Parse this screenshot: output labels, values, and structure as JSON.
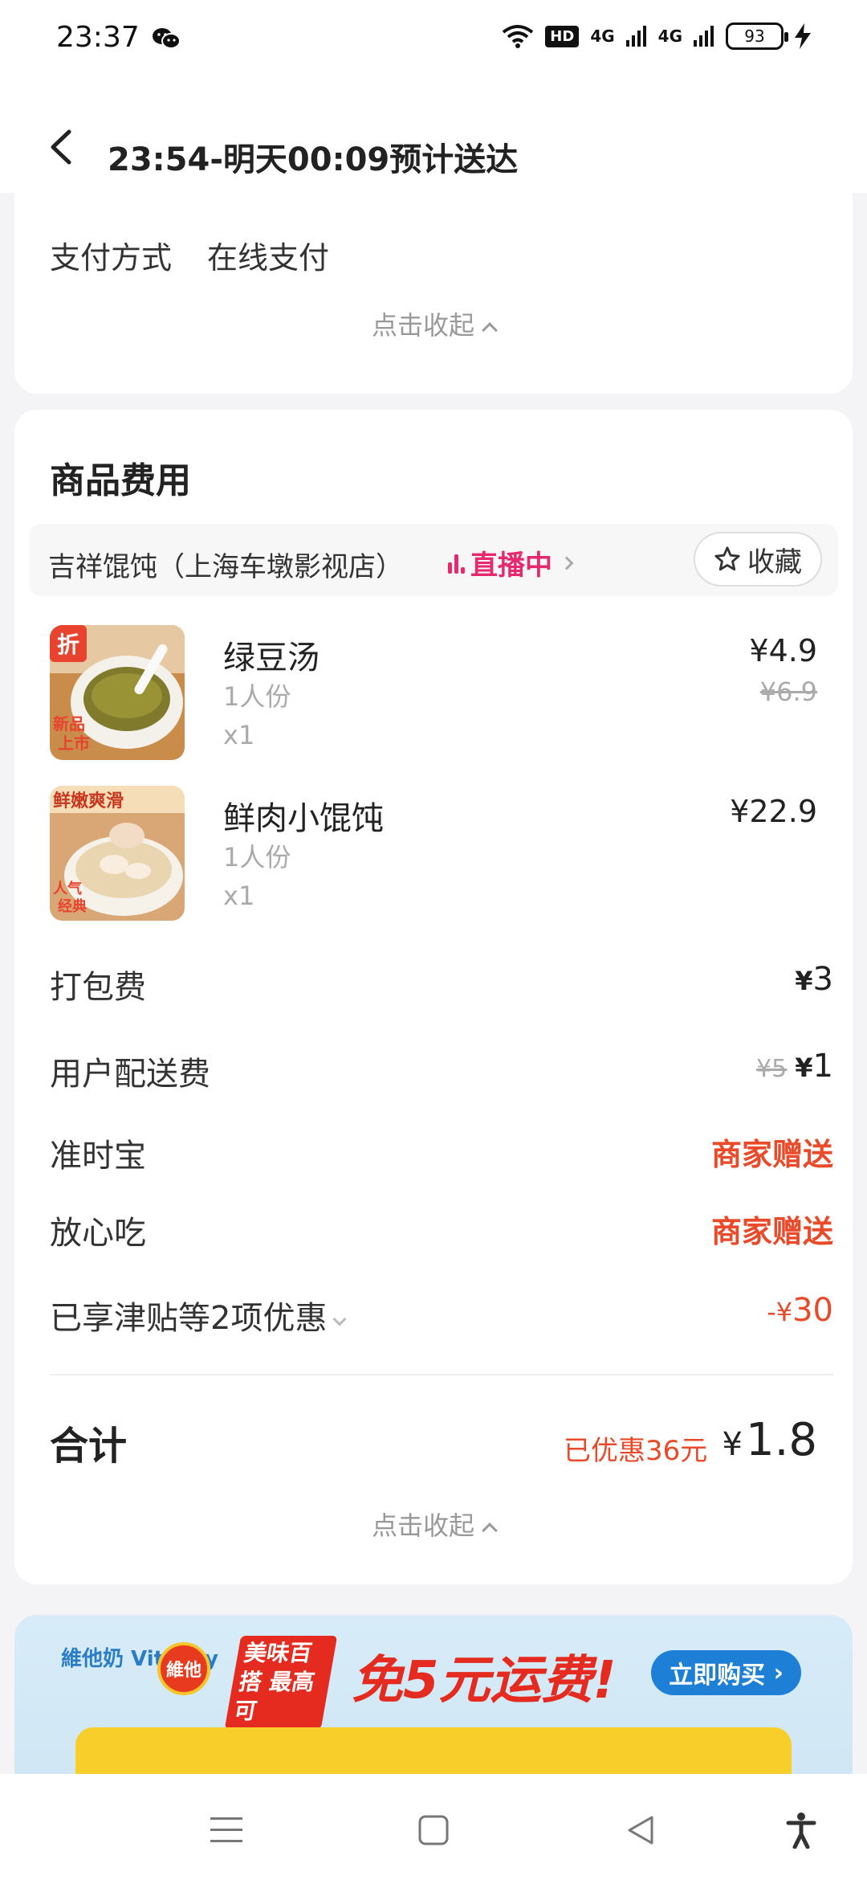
{
  "status_bar": {
    "time": "23:37",
    "hd_label": "HD",
    "signal1": "4G",
    "signal2": "4G",
    "battery": "93",
    "icons": [
      "wechat-icon",
      "wifi-icon",
      "signal-icon",
      "battery-icon",
      "charging-icon"
    ]
  },
  "header": {
    "title": "23:54-明天00:09预计送达"
  },
  "payment": {
    "label": "支付方式",
    "value": "在线支付",
    "collapse_label": "点击收起"
  },
  "fees": {
    "section_title": "商品费用",
    "shop": {
      "name": "吉祥馄饨（上海车墩影视店）",
      "live_label": "直播中",
      "favorite_label": "收藏"
    },
    "items": [
      {
        "name": "绿豆汤",
        "spec": "1人份",
        "qty": "x1",
        "price": "¥4.9",
        "original_price": "¥6.9",
        "badge": "折",
        "tag": "新品上市"
      },
      {
        "name": "鲜肉小馄饨",
        "spec": "1人份",
        "qty": "x1",
        "price": "¥22.9",
        "badge": "鲜嫩爽滑",
        "tag": "人气经典"
      }
    ],
    "packing": {
      "label": "打包费",
      "value": "3"
    },
    "delivery": {
      "label": "用户配送费",
      "original": "¥5",
      "value": "1"
    },
    "ontime": {
      "label": "准时宝",
      "value": "商家赠送"
    },
    "safe": {
      "label": "放心吃",
      "value": "商家赠送"
    },
    "discounts": {
      "label": "已享津贴等2项优惠",
      "value": "30"
    },
    "total": {
      "label": "合计",
      "saved": "已优惠36元",
      "amount": "1.8"
    },
    "collapse_label": "点击收起"
  },
  "ad": {
    "brand": "維他奶 Vitasoy",
    "brand2": "維他",
    "slogan": "美味百搭 最高可",
    "headline": "免5元运费!",
    "button": "立即购买",
    "accent": "#e52b1f"
  },
  "colors": {
    "accent_red": "#e84a2a",
    "live_pink": "#e6286e"
  }
}
